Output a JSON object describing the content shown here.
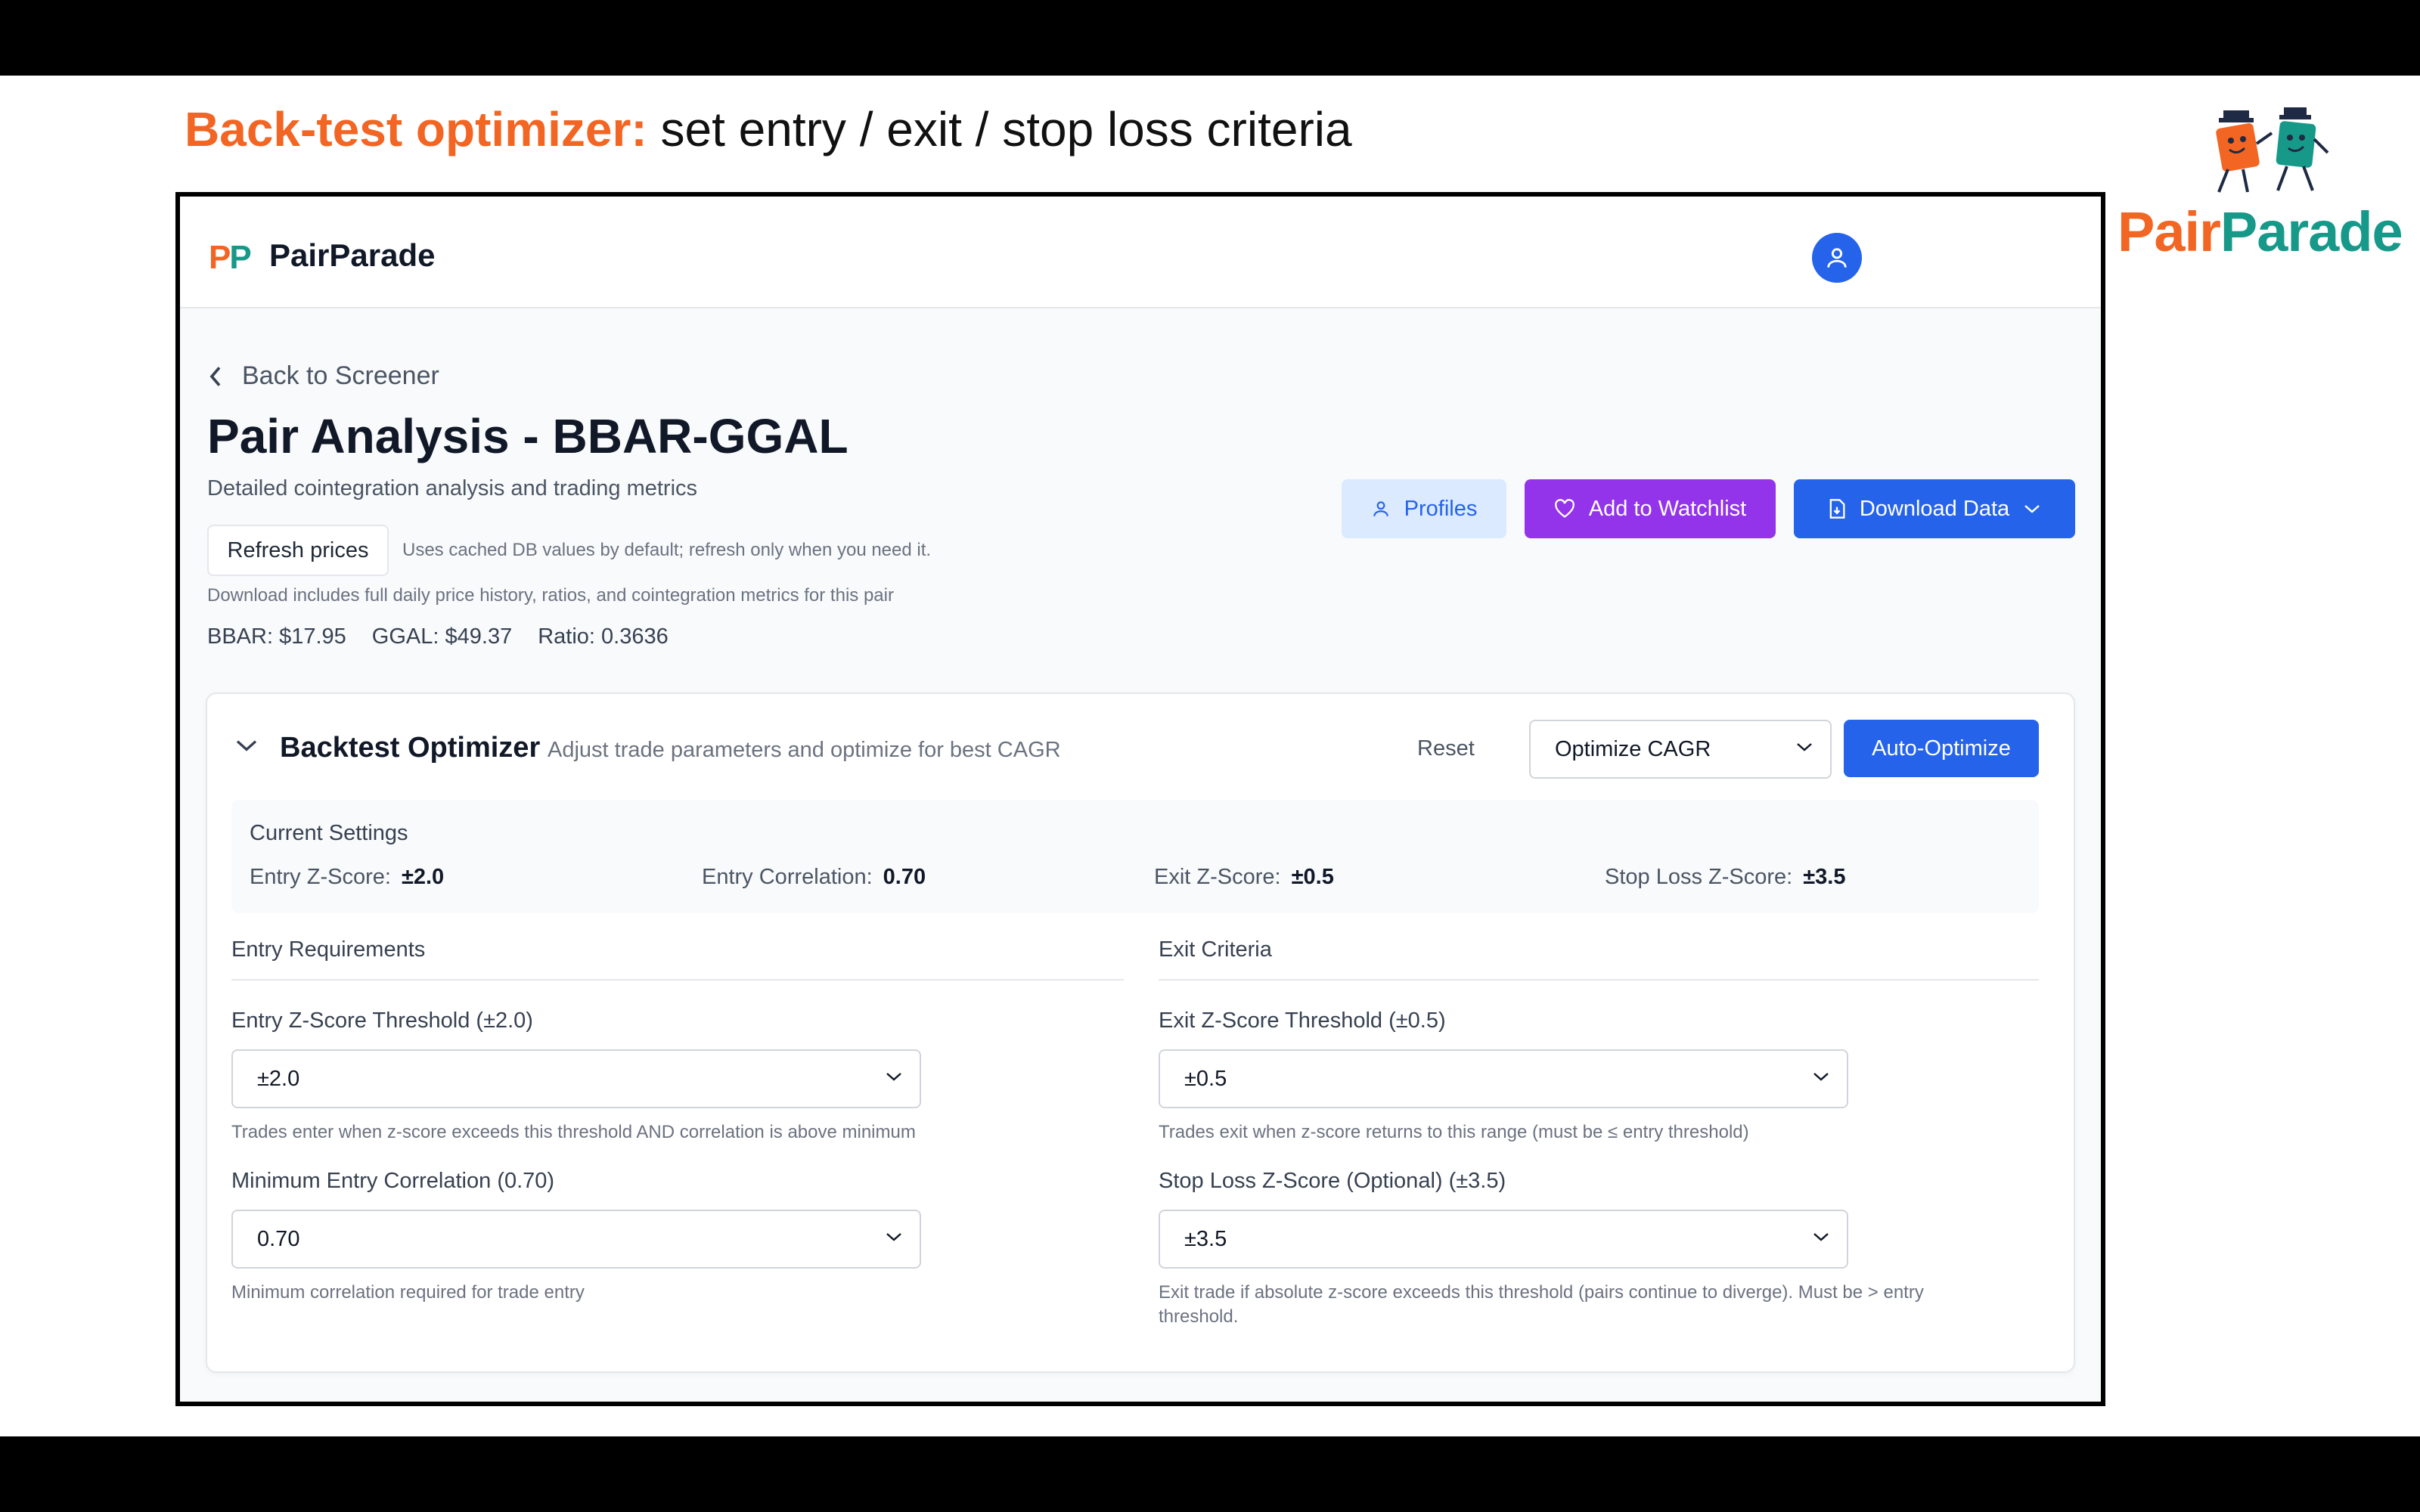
{
  "slide": {
    "title_accent": "Back-test optimizer:",
    "title_rest": " set entry / exit / stop loss criteria",
    "brand_part1": "Pair",
    "brand_part2": "Parade"
  },
  "header": {
    "logo_p1": "P",
    "logo_p2": "P",
    "app_name": "PairParade"
  },
  "page": {
    "back_label": "Back to Screener",
    "title": "Pair Analysis - BBAR-GGAL",
    "subtitle": "Detailed cointegration analysis and trading metrics",
    "refresh_label": "Refresh prices",
    "refresh_note": "Uses cached DB values by default; refresh only when you need it.",
    "download_note": "Download includes full daily price history, ratios, and cointegration metrics for this pair",
    "prices": {
      "bbar": "BBAR: $17.95",
      "ggal": "GGAL: $49.37",
      "ratio": "Ratio: 0.3636"
    }
  },
  "actions": {
    "profiles": "Profiles",
    "watchlist": "Add to Watchlist",
    "download": "Download Data"
  },
  "optimizer": {
    "title": "Backtest Optimizer",
    "description": "Adjust trade parameters and optimize for best CAGR",
    "reset": "Reset",
    "optimize_target": "Optimize CAGR",
    "auto_optimize": "Auto-Optimize",
    "current_settings": {
      "label": "Current Settings",
      "entry_z_label": "Entry Z-Score:",
      "entry_z": "±2.0",
      "entry_corr_label": "Entry Correlation:",
      "entry_corr": "0.70",
      "exit_z_label": "Exit Z-Score:",
      "exit_z": "±0.5",
      "stop_label": "Stop Loss Z-Score:",
      "stop_z": "±3.5"
    },
    "entry": {
      "heading": "Entry Requirements",
      "z_label": "Entry Z-Score Threshold (±2.0)",
      "z_value": "±2.0",
      "z_help": "Trades enter when z-score exceeds this threshold AND correlation is above minimum",
      "corr_label": "Minimum Entry Correlation (0.70)",
      "corr_value": "0.70",
      "corr_help": "Minimum correlation required for trade entry"
    },
    "exit": {
      "heading": "Exit Criteria",
      "z_label": "Exit Z-Score Threshold (±0.5)",
      "z_value": "±0.5",
      "z_help": "Trades exit when z-score returns to this range (must be ≤ entry threshold)",
      "stop_label": "Stop Loss Z-Score (Optional) (±3.5)",
      "stop_value": "±3.5",
      "stop_help": "Exit trade if absolute z-score exceeds this threshold (pairs continue to diverge). Must be > entry threshold."
    }
  },
  "colors": {
    "accent_orange": "#f26522",
    "accent_teal": "#17998a",
    "primary_blue": "#2563eb",
    "watchlist_purple": "#9333ea"
  }
}
